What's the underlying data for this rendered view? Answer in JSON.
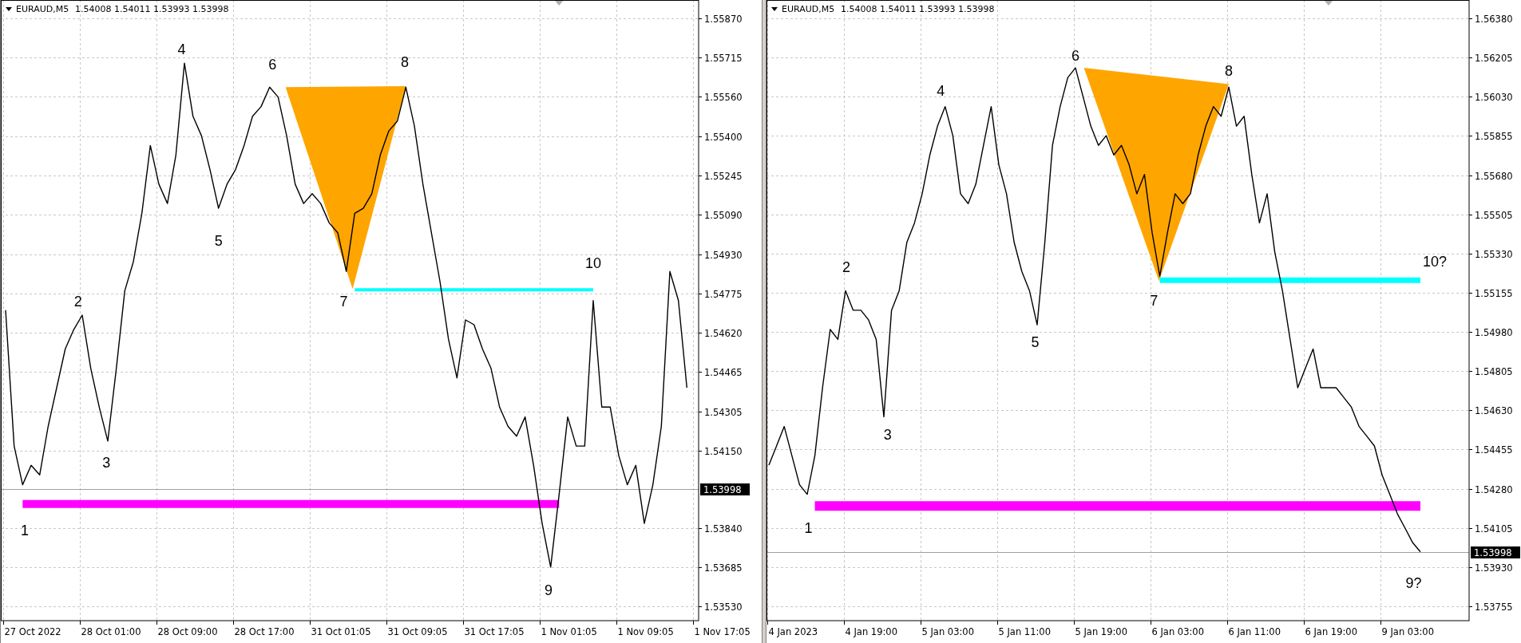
{
  "charts": [
    {
      "header": {
        "symbol": "EURAUD,M5",
        "quotes": "1.54008 1.54011 1.53993 1.53998"
      },
      "current_price": {
        "label": "1.53998"
      },
      "chart_data": {
        "type": "line",
        "categories": [
          null,
          null,
          null,
          "27 Oct 2022",
          null,
          null,
          null,
          null,
          null,
          null,
          null,
          null,
          "28 Oct 01:00",
          null,
          null,
          null,
          null,
          null,
          null,
          null,
          null,
          "28 Oct 09:00",
          null,
          null,
          null,
          null,
          null,
          null,
          null,
          null,
          "28 Oct 17:00",
          null,
          null,
          null,
          null,
          null,
          null,
          null,
          null,
          "31 Oct 01:05",
          null,
          null,
          null,
          null,
          null,
          null,
          null,
          null,
          "31 Oct 09:05",
          null,
          null,
          null,
          null,
          null,
          null,
          null,
          null,
          "31 Oct 17:05",
          null,
          null,
          null,
          null,
          null,
          null,
          null,
          null,
          "1 Nov 01:05",
          null,
          null,
          null,
          null,
          null,
          null,
          null,
          null,
          "1 Nov 09:05",
          null,
          null,
          null,
          null,
          null,
          null,
          null,
          null,
          "1 Nov 17:05"
        ],
        "series": [
          {
            "color": "#000000",
            "values": [
              1.54709,
              1.54168,
              1.54014,
              1.54091,
              1.54053,
              1.54246,
              1.544,
              1.54554,
              1.54631,
              1.54689,
              1.54477,
              1.54323,
              1.54188,
              1.54477,
              1.54786,
              1.54901,
              1.55094,
              1.55364,
              1.5521,
              1.55133,
              1.55326,
              1.55692,
              1.5548,
              1.55403,
              1.55268,
              1.55114,
              1.5521,
              1.55268,
              1.55364,
              1.5548,
              1.55519,
              1.55596,
              1.55557,
              1.55403,
              1.5521,
              1.55133,
              1.55172,
              1.55133,
              1.55056,
              1.55017,
              1.54863,
              1.55094,
              1.55114,
              1.55172,
              1.55326,
              1.55422,
              1.55461,
              1.55596,
              1.55442,
              1.5521,
              1.55017,
              1.54824,
              1.54593,
              1.54439,
              1.5467,
              1.54651,
              1.54554,
              1.54477,
              1.54323,
              1.54246,
              1.54207,
              1.54284,
              1.54091,
              1.5386,
              1.53686,
              1.53976,
              1.54284,
              1.54168,
              1.54168,
              1.54747,
              1.54323,
              1.54323,
              1.5413,
              1.54014,
              1.54091,
              1.5386,
              1.54014,
              1.54246,
              1.54863,
              1.54747,
              1.544,
              null,
              null,
              null,
              null
            ]
          }
        ],
        "ylim": [
          1.53473,
          1.55943
        ],
        "grid": true,
        "ref_lines": [
          {
            "axis": "y",
            "value": 1.53998,
            "color": "#a0a0a0"
          },
          {
            "axis": "y",
            "value": 1.5479,
            "color": "#00ffff"
          },
          {
            "axis": "y",
            "value": 1.53937,
            "color": "#ff00ff"
          }
        ],
        "yticks": [
          {
            "value": 1.5587,
            "label": "1.55870"
          },
          {
            "value": 1.55715,
            "label": "1.55715"
          },
          {
            "value": 1.5556,
            "label": "1.55560"
          },
          {
            "value": 1.554,
            "label": "1.55400"
          },
          {
            "value": 1.55245,
            "label": "1.55245"
          },
          {
            "value": 1.5509,
            "label": "1.55090"
          },
          {
            "value": 1.5493,
            "label": "1.54930"
          },
          {
            "value": 1.54775,
            "label": "1.54775"
          },
          {
            "value": 1.5462,
            "label": "1.54620"
          },
          {
            "value": 1.54465,
            "label": "1.54465"
          },
          {
            "value": 1.54305,
            "label": "1.54305"
          },
          {
            "value": 1.5415,
            "label": "1.54150"
          },
          {
            "value": 1.5384,
            "label": "1.53840"
          },
          {
            "value": 1.53685,
            "label": "1.53685"
          },
          {
            "value": 1.5353,
            "label": "1.53530"
          }
        ],
        "annotations": [
          "1",
          "2",
          "3",
          "4",
          "5",
          "6",
          "7",
          "8",
          "9",
          "10"
        ]
      },
      "pattern": {
        "triangle": {
          "color": "#ffa500"
        }
      }
    },
    {
      "header": {
        "symbol": "EURAUD,M5",
        "quotes": "1.54008 1.54011 1.53993 1.53998"
      },
      "current_price": {
        "label": "1.53998"
      },
      "chart_data": {
        "type": "line",
        "categories": [
          null,
          null,
          null,
          "4 Jan 2023",
          null,
          null,
          null,
          null,
          null,
          null,
          null,
          null,
          null,
          "4 Jan 19:00",
          null,
          null,
          null,
          null,
          null,
          null,
          null,
          null,
          null,
          "5 Jan 03:00",
          null,
          null,
          null,
          null,
          null,
          null,
          null,
          null,
          null,
          "5 Jan 11:00",
          null,
          null,
          null,
          null,
          null,
          null,
          null,
          null,
          null,
          "5 Jan 19:00",
          null,
          null,
          null,
          null,
          null,
          null,
          null,
          null,
          null,
          "6 Jan 03:00",
          null,
          null,
          null,
          null,
          null,
          null,
          null,
          null,
          null,
          "6 Jan 11:00",
          null,
          null,
          null,
          null,
          null,
          null,
          null,
          null,
          null,
          "6 Jan 19:00",
          null,
          null,
          null,
          null,
          null,
          null,
          null,
          null,
          null,
          "9 Jan 03:00",
          null,
          null
        ],
        "series": [
          {
            "color": "#000000",
            "values": [
              1.54385,
              1.54471,
              1.54558,
              1.54428,
              1.54298,
              1.54255,
              1.54428,
              1.54731,
              1.54991,
              1.54947,
              1.55164,
              1.55077,
              1.55077,
              1.55034,
              1.54947,
              1.54601,
              1.55077,
              1.55164,
              1.5538,
              1.55467,
              1.55597,
              1.5577,
              1.55899,
              1.55986,
              1.55856,
              1.55597,
              1.55553,
              1.5564,
              1.55813,
              1.55986,
              1.55726,
              1.55597,
              1.5538,
              1.5525,
              1.55164,
              1.55012,
              1.5538,
              1.55813,
              1.55986,
              1.56116,
              1.56159,
              1.56029,
              1.55899,
              1.55813,
              1.55856,
              1.5577,
              1.55813,
              1.55726,
              1.55597,
              1.55683,
              1.55423,
              1.55229,
              1.55423,
              1.55597,
              1.55553,
              1.55597,
              1.5577,
              1.55899,
              1.55986,
              1.55943,
              1.56073,
              1.55899,
              1.55943,
              1.55683,
              1.55467,
              1.55597,
              1.55337,
              1.55164,
              1.54947,
              1.54731,
              1.54818,
              1.54904,
              1.54731,
              1.54731,
              1.54731,
              1.54688,
              1.54644,
              1.54558,
              1.54515,
              1.54471,
              1.54342,
              1.54255,
              1.54168,
              1.54104,
              1.54039,
              1.53998
            ]
          }
        ],
        "ylim": [
          1.53691,
          1.56462
        ],
        "grid": true,
        "ref_lines": [
          {
            "axis": "y",
            "value": 1.53998,
            "color": "#a0a0a0"
          },
          {
            "axis": "y",
            "value": 1.55211,
            "color": "#00ffff"
          },
          {
            "axis": "y",
            "value": 1.54203,
            "color": "#ff00ff"
          }
        ],
        "yticks": [
          {
            "value": 1.5638,
            "label": "1.56380"
          },
          {
            "value": 1.56205,
            "label": "1.56205"
          },
          {
            "value": 1.5603,
            "label": "1.56030"
          },
          {
            "value": 1.55855,
            "label": "1.55855"
          },
          {
            "value": 1.5568,
            "label": "1.55680"
          },
          {
            "value": 1.55505,
            "label": "1.55505"
          },
          {
            "value": 1.5533,
            "label": "1.55330"
          },
          {
            "value": 1.55155,
            "label": "1.55155"
          },
          {
            "value": 1.5498,
            "label": "1.54980"
          },
          {
            "value": 1.54805,
            "label": "1.54805"
          },
          {
            "value": 1.5463,
            "label": "1.54630"
          },
          {
            "value": 1.54455,
            "label": "1.54455"
          },
          {
            "value": 1.5428,
            "label": "1.54280"
          },
          {
            "value": 1.54105,
            "label": "1.54105"
          },
          {
            "value": 1.5393,
            "label": "1.53930"
          },
          {
            "value": 1.53755,
            "label": "1.53755"
          }
        ],
        "annotations": [
          "1",
          "2",
          "3",
          "4",
          "5",
          "6",
          "7",
          "8",
          "9?",
          "10?"
        ]
      },
      "pattern": {
        "triangle": {
          "color": "#ffa500"
        }
      }
    }
  ]
}
